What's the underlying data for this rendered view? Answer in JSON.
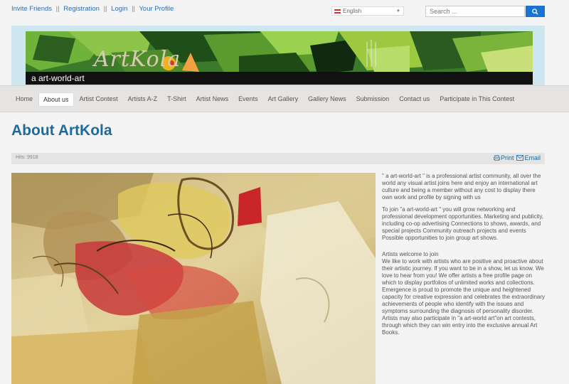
{
  "toplinks": {
    "invite": "Invite Friends",
    "registration": "Registration",
    "login": "Login",
    "profile": "Your Profile",
    "sep": "||"
  },
  "language": {
    "selected": "English"
  },
  "search": {
    "placeholder": "Search ..."
  },
  "banner": {
    "logo_text": "ArtKola",
    "caption": "a art-world-art"
  },
  "nav": {
    "items": [
      "Home",
      "About us",
      "Artist Contest",
      "Artists A-Z",
      "T-Shirt",
      "Artist News",
      "Events",
      "Art Gallery",
      "Gallery News",
      "Submission",
      "Contact us",
      "Participate in This Contest"
    ],
    "active_index": 1
  },
  "page": {
    "title": "About ArtKola",
    "hits": "Hits: 9918",
    "print": "Print",
    "email": "Email"
  },
  "article": {
    "p1": "\" a art-world-art \" is a professional artist community, all over the world any visual artist joins here and enjoy an international art culture and being a member without any cost to display there own work and profile by signing with us",
    "p2": "To join \"a art-world-art \" you will grow networking and professional development opportunities. Marketing and publicity, including co-op advertising Connections to shows, awards, and special projects Community outreach projects and events Possible opportunities to join group art shows.",
    "p3_heading": "Artists welcome to join",
    "p3": "We like to work with artists who are positive and proactive about their artistic journey. If you want to be in a show, let us know. We love to hear from you! We offer artists a free profile page on which to display portfolios of unlimited works and collections. Emergence is proud to promote the unique and heightened capacity for creative expression and celebrates the extraordinary achievements of people who identify with the issues and symptoms surrounding the diagnosis of personality disorder. Artists may also participate in \"a art-world art\"on art contests, through which they can win entry into the exclusive annual Art Books."
  },
  "colors": {
    "link": "#2a6db0",
    "title": "#1d6b9a",
    "search_button": "#1a73d1",
    "nav_bg": "#e6e4e2"
  }
}
